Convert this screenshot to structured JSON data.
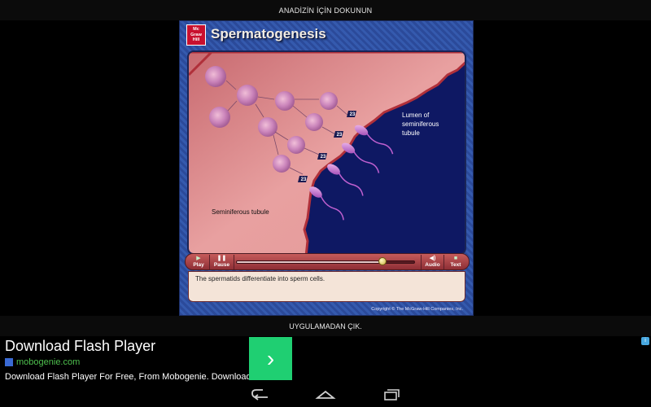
{
  "top_bar": {
    "text": "ANADİZİN İÇİN DOKUNUN"
  },
  "flash": {
    "logo_text": "Mc\nGraw\nHill",
    "title": "Spermatogenesis",
    "labels": {
      "seminiferous_tubule": "Seminiferous tubule",
      "lumen_line1": "Lumen of",
      "lumen_line2": "seminiferous",
      "lumen_line3": "tubule"
    },
    "chromosome_badges": [
      "23",
      "23",
      "23",
      "23"
    ],
    "controls": {
      "play": "Play",
      "pause": "Pause",
      "audio": "Audio",
      "text": "Text",
      "progress": 0.82
    },
    "caption": "The spermatids differentiate into sperm cells.",
    "copyright": "Copyright © The McGraw-Hill Companies, Inc."
  },
  "exit_bar": {
    "text": "UYGULAMADAN ÇIK."
  },
  "ad": {
    "title": "Download Flash Player",
    "domain": "mobogenie.com",
    "description": "Download Flash Player For Free, From Mobogenie. Download",
    "arrow": "›"
  },
  "colors": {
    "tissue": "#d98a8c",
    "lumen": "#0e1863",
    "ad_button": "#1fcf72",
    "ad_domain": "#4ec04e"
  }
}
